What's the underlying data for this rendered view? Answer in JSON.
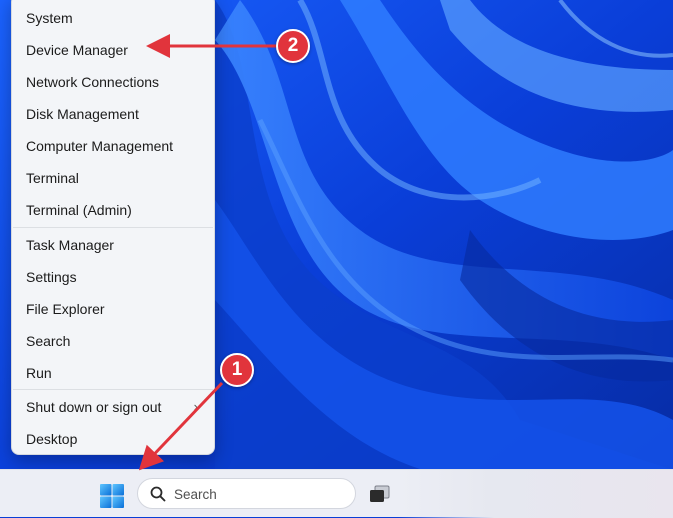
{
  "context_menu": {
    "items": [
      {
        "label": "System"
      },
      {
        "label": "Device Manager"
      },
      {
        "label": "Network Connections"
      },
      {
        "label": "Disk Management"
      },
      {
        "label": "Computer Management"
      },
      {
        "label": "Terminal"
      },
      {
        "label": "Terminal (Admin)"
      },
      {
        "label": "Task Manager"
      },
      {
        "label": "Settings"
      },
      {
        "label": "File Explorer"
      },
      {
        "label": "Search"
      },
      {
        "label": "Run"
      },
      {
        "label": "Shut down or sign out",
        "has_submenu": true
      },
      {
        "label": "Desktop"
      }
    ]
  },
  "taskbar": {
    "start_icon": "windows-logo-icon",
    "search": {
      "placeholder": "Search",
      "icon": "search-icon"
    },
    "task_view_icon": "task-view-icon"
  },
  "annotations": {
    "badge_1": "1",
    "badge_2": "2",
    "color": "#e1343c"
  }
}
